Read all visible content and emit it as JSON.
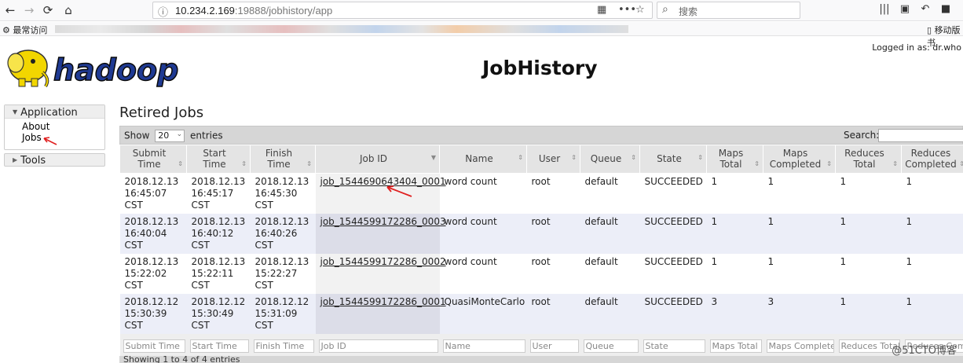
{
  "browser": {
    "url_host": "10.234.2.169",
    "url_rest": ":19888/jobhistory/app",
    "search_placeholder": "搜索",
    "bookmark_first": "最常访问",
    "bookmark_mobile": "移动版书"
  },
  "header": {
    "logo_text": "hadoop",
    "logged_in": "Logged in as: dr.who",
    "title": "JobHistory"
  },
  "nav": {
    "application": "Application",
    "about": "About",
    "jobs": "Jobs",
    "tools": "Tools"
  },
  "section_title": "Retired Jobs",
  "controls": {
    "show": "Show",
    "entries_value": "20",
    "entries": "entries",
    "search": "Search:"
  },
  "columns": [
    "Submit Time",
    "Start Time",
    "Finish Time",
    "Job ID",
    "Name",
    "User",
    "Queue",
    "State",
    "Maps Total",
    "Maps Completed",
    "Reduces Total",
    "Reduces Completed"
  ],
  "rows": [
    [
      "2018.12.13 16:45:07 CST",
      "2018.12.13 16:45:17 CST",
      "2018.12.13 16:45:30 CST",
      "job_1544690643404_0001",
      "word count",
      "root",
      "default",
      "SUCCEEDED",
      "1",
      "1",
      "1",
      "1"
    ],
    [
      "2018.12.13 16:40:04 CST",
      "2018.12.13 16:40:12 CST",
      "2018.12.13 16:40:26 CST",
      "job_1544599172286_0003",
      "word count",
      "root",
      "default",
      "SUCCEEDED",
      "1",
      "1",
      "1",
      "1"
    ],
    [
      "2018.12.13 15:22:02 CST",
      "2018.12.13 15:22:11 CST",
      "2018.12.13 15:22:27 CST",
      "job_1544599172286_0002",
      "word count",
      "root",
      "default",
      "SUCCEEDED",
      "1",
      "1",
      "1",
      "1"
    ],
    [
      "2018.12.12 15:30:39 CST",
      "2018.12.12 15:30:49 CST",
      "2018.12.12 15:31:09 CST",
      "job_1544599172286_0001",
      "QuasiMonteCarlo",
      "root",
      "default",
      "SUCCEEDED",
      "3",
      "3",
      "1",
      "1"
    ]
  ],
  "footer_filters": [
    "Submit Time",
    "Start Time",
    "Finish Time",
    "Job ID",
    "Name",
    "User",
    "Queue",
    "State",
    "Maps Total",
    "Maps Completed",
    "Reduces Total",
    "Reduces Completed"
  ],
  "info": "Showing 1 to 4 of 4 entries",
  "watermark": "@51CTO博客",
  "colors": {
    "accent_red": "#e02020",
    "logo_yellow": "#f2d600",
    "logo_blue": "#1f3a93"
  }
}
